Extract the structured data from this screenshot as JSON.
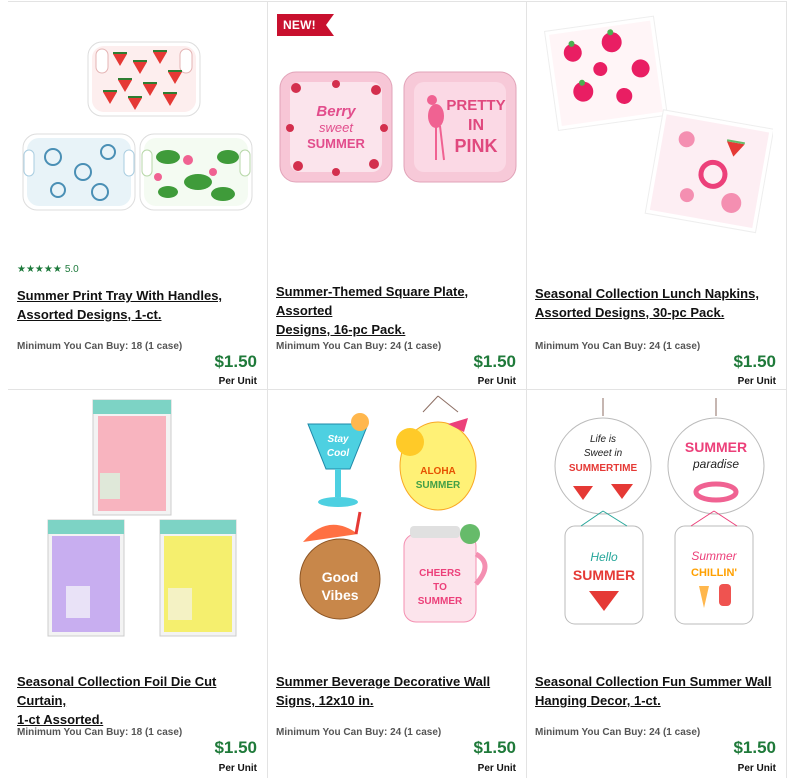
{
  "products": [
    {
      "badge": "",
      "rating": {
        "stars": "★★★★★",
        "value": "5.0"
      },
      "title_line1": "Summer Print Tray With Handles,",
      "title_line2": "Assorted Designs, 1-ct.",
      "min_buy": "Minimum You Can Buy: 18 (1 case)",
      "price": "$1.50",
      "unit": "Per Unit"
    },
    {
      "badge": "NEW!",
      "title_line1": "Summer-Themed Square Plate, Assorted",
      "title_line2": "Designs, 16-pc Pack.",
      "min_buy": "Minimum You Can Buy: 24 (1 case)",
      "price": "$1.50",
      "unit": "Per Unit",
      "plate_text_1": "Berry sweet SUMMER",
      "plate_text_2": "PRETTY IN PINK"
    },
    {
      "badge": "",
      "title_line1": "Seasonal Collection Lunch Napkins,",
      "title_line2": "Assorted Designs, 30-pc Pack.",
      "min_buy": "Minimum You Can Buy: 24 (1 case)",
      "price": "$1.50",
      "unit": "Per Unit"
    },
    {
      "badge": "",
      "title_line1": "Seasonal Collection Foil Die Cut Curtain,",
      "title_line2": "1-ct Assorted.",
      "min_buy": "Minimum You Can Buy: 18 (1 case)",
      "price": "$1.50",
      "unit": "Per Unit"
    },
    {
      "badge": "",
      "title_line1": "Summer Beverage Decorative Wall",
      "title_line2": "Signs, 12x10 in.",
      "min_buy": "Minimum You Can Buy: 24 (1 case)",
      "price": "$1.50",
      "unit": "Per Unit",
      "sign_texts": [
        "Stay Cool",
        "ALOHA SUMMER",
        "Good Vibes",
        "CHEERS TO SUMMER"
      ]
    },
    {
      "badge": "",
      "title_line1": "Seasonal Collection Fun Summer Wall",
      "title_line2": "Hanging Decor, 1-ct.",
      "min_buy": "Minimum You Can Buy: 24 (1 case)",
      "price": "$1.50",
      "unit": "Per Unit",
      "sign_texts": [
        "Life is Sweet in SUMMERTIME",
        "SUMMER paradise",
        "Hello SUMMER",
        "Summer CHILLIN'"
      ]
    }
  ],
  "colors": {
    "price": "#1f7a3a",
    "badge": "#c8102e",
    "rating": "#1e7a3c"
  }
}
